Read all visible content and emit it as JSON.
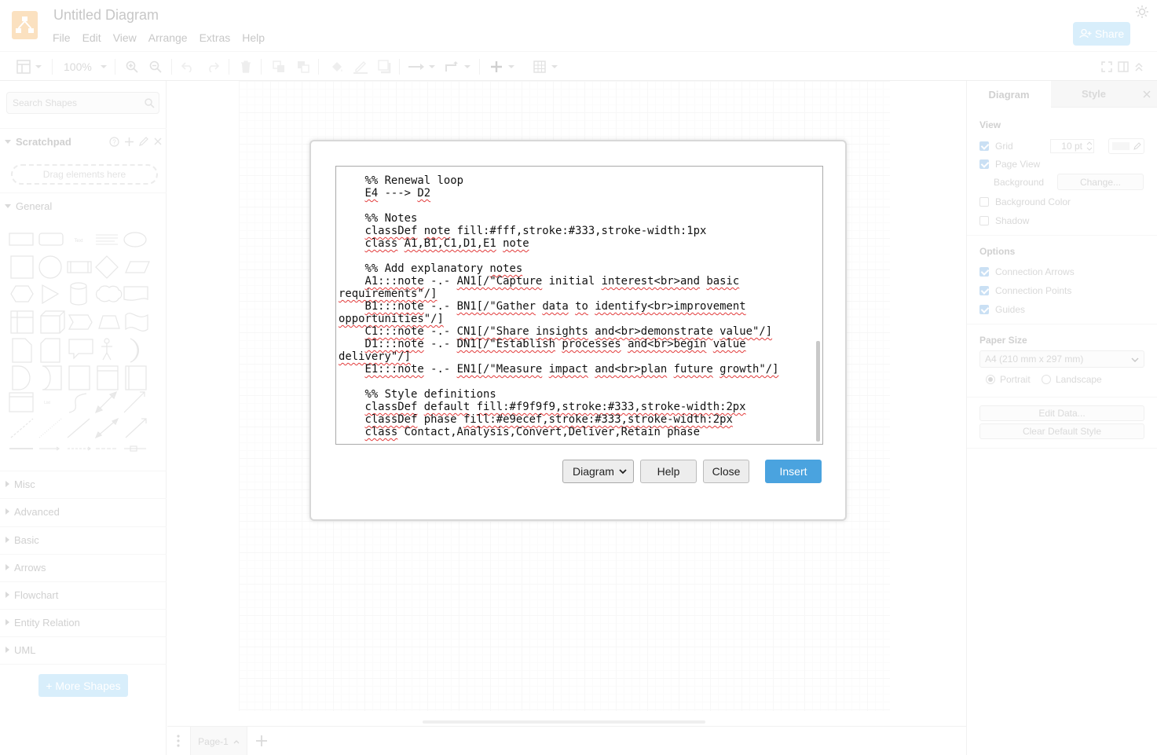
{
  "header": {
    "title": "Untitled Diagram",
    "menu": [
      "File",
      "Edit",
      "View",
      "Arrange",
      "Extras",
      "Help"
    ],
    "share_label": "Share"
  },
  "toolbar": {
    "zoom": "100%",
    "icons": [
      "sidebar-toggle-icon",
      "zoom-in-icon",
      "zoom-out-icon",
      "undo-icon",
      "redo-icon",
      "delete-icon",
      "to-front-icon",
      "to-back-icon",
      "fill-color-icon",
      "line-color-icon",
      "shadow-icon",
      "connection-icon",
      "waypoints-icon",
      "insert-icon",
      "table-icon",
      "fullscreen-icon",
      "format-panel-icon",
      "collapse-icon"
    ]
  },
  "left_panel": {
    "search_placeholder": "Search Shapes",
    "scratchpad": {
      "label": "Scratchpad",
      "drop_hint": "Drag elements here"
    },
    "general_label": "General",
    "sections": [
      "Misc",
      "Advanced",
      "Basic",
      "Arrows",
      "Flowchart",
      "Entity Relation",
      "UML"
    ],
    "more_shapes": "+ More Shapes"
  },
  "bottom": {
    "page_tab": "Page-1"
  },
  "right_panel": {
    "tabs": [
      "Diagram",
      "Style"
    ],
    "view_title": "View",
    "grid_label": "Grid",
    "grid_size": "10 pt",
    "page_view_label": "Page View",
    "background_label": "Background",
    "change_button": "Change...",
    "background_color_label": "Background Color",
    "shadow_label": "Shadow",
    "options_title": "Options",
    "connection_arrows": "Connection Arrows",
    "connection_points": "Connection Points",
    "guides": "Guides",
    "paper_size_title": "Paper Size",
    "paper_size_value": "A4 (210 mm x 297 mm)",
    "portrait": "Portrait",
    "landscape": "Landscape",
    "edit_data": "Edit Data...",
    "clear_default_style": "Clear Default Style"
  },
  "dialog": {
    "type_select": "Diagram",
    "help_label": "Help",
    "close_label": "Close",
    "insert_label": "Insert",
    "code_lines": [
      "    ^^^^^^^^     ^^^^^^^^",
      "    %% Renewal loop",
      "    E4 ---> D2",
      "",
      "    %% Notes",
      "    classDef note fill:#fff,stroke:#333,stroke-width:1px",
      "    class A1,B1,C1,D1,E1 note",
      "",
      "    %% Add explanatory notes",
      "    A1:::note -.- AN1[/\"Capture initial interest<br>and basic",
      "requirements\"/]",
      "    B1:::note -.- BN1[/\"Gather data to identify<br>improvement",
      "opportunities\"/]",
      "    C1:::note -.- CN1[/\"Share insights and<br>demonstrate value\"/]",
      "    D1:::note -.- DN1[/\"Establish processes and<br>begin value",
      "delivery\"/]",
      "    E1:::note -.- EN1[/\"Measure impact and<br>plan future growth\"/]",
      "",
      "    %% Style definitions",
      "    classDef default fill:#f9f9f9,stroke:#333,stroke-width:2px",
      "    classDef phase fill:#e9ecef,stroke:#333,stroke-width:2px",
      "    class Contact,Analysis,Convert,Deliver,Retain phase"
    ]
  },
  "colors": {
    "accent": "#4aa3df",
    "share_button": "#b9e1f8",
    "logo": "#f08705",
    "spellcheck": "#e23b3b"
  }
}
